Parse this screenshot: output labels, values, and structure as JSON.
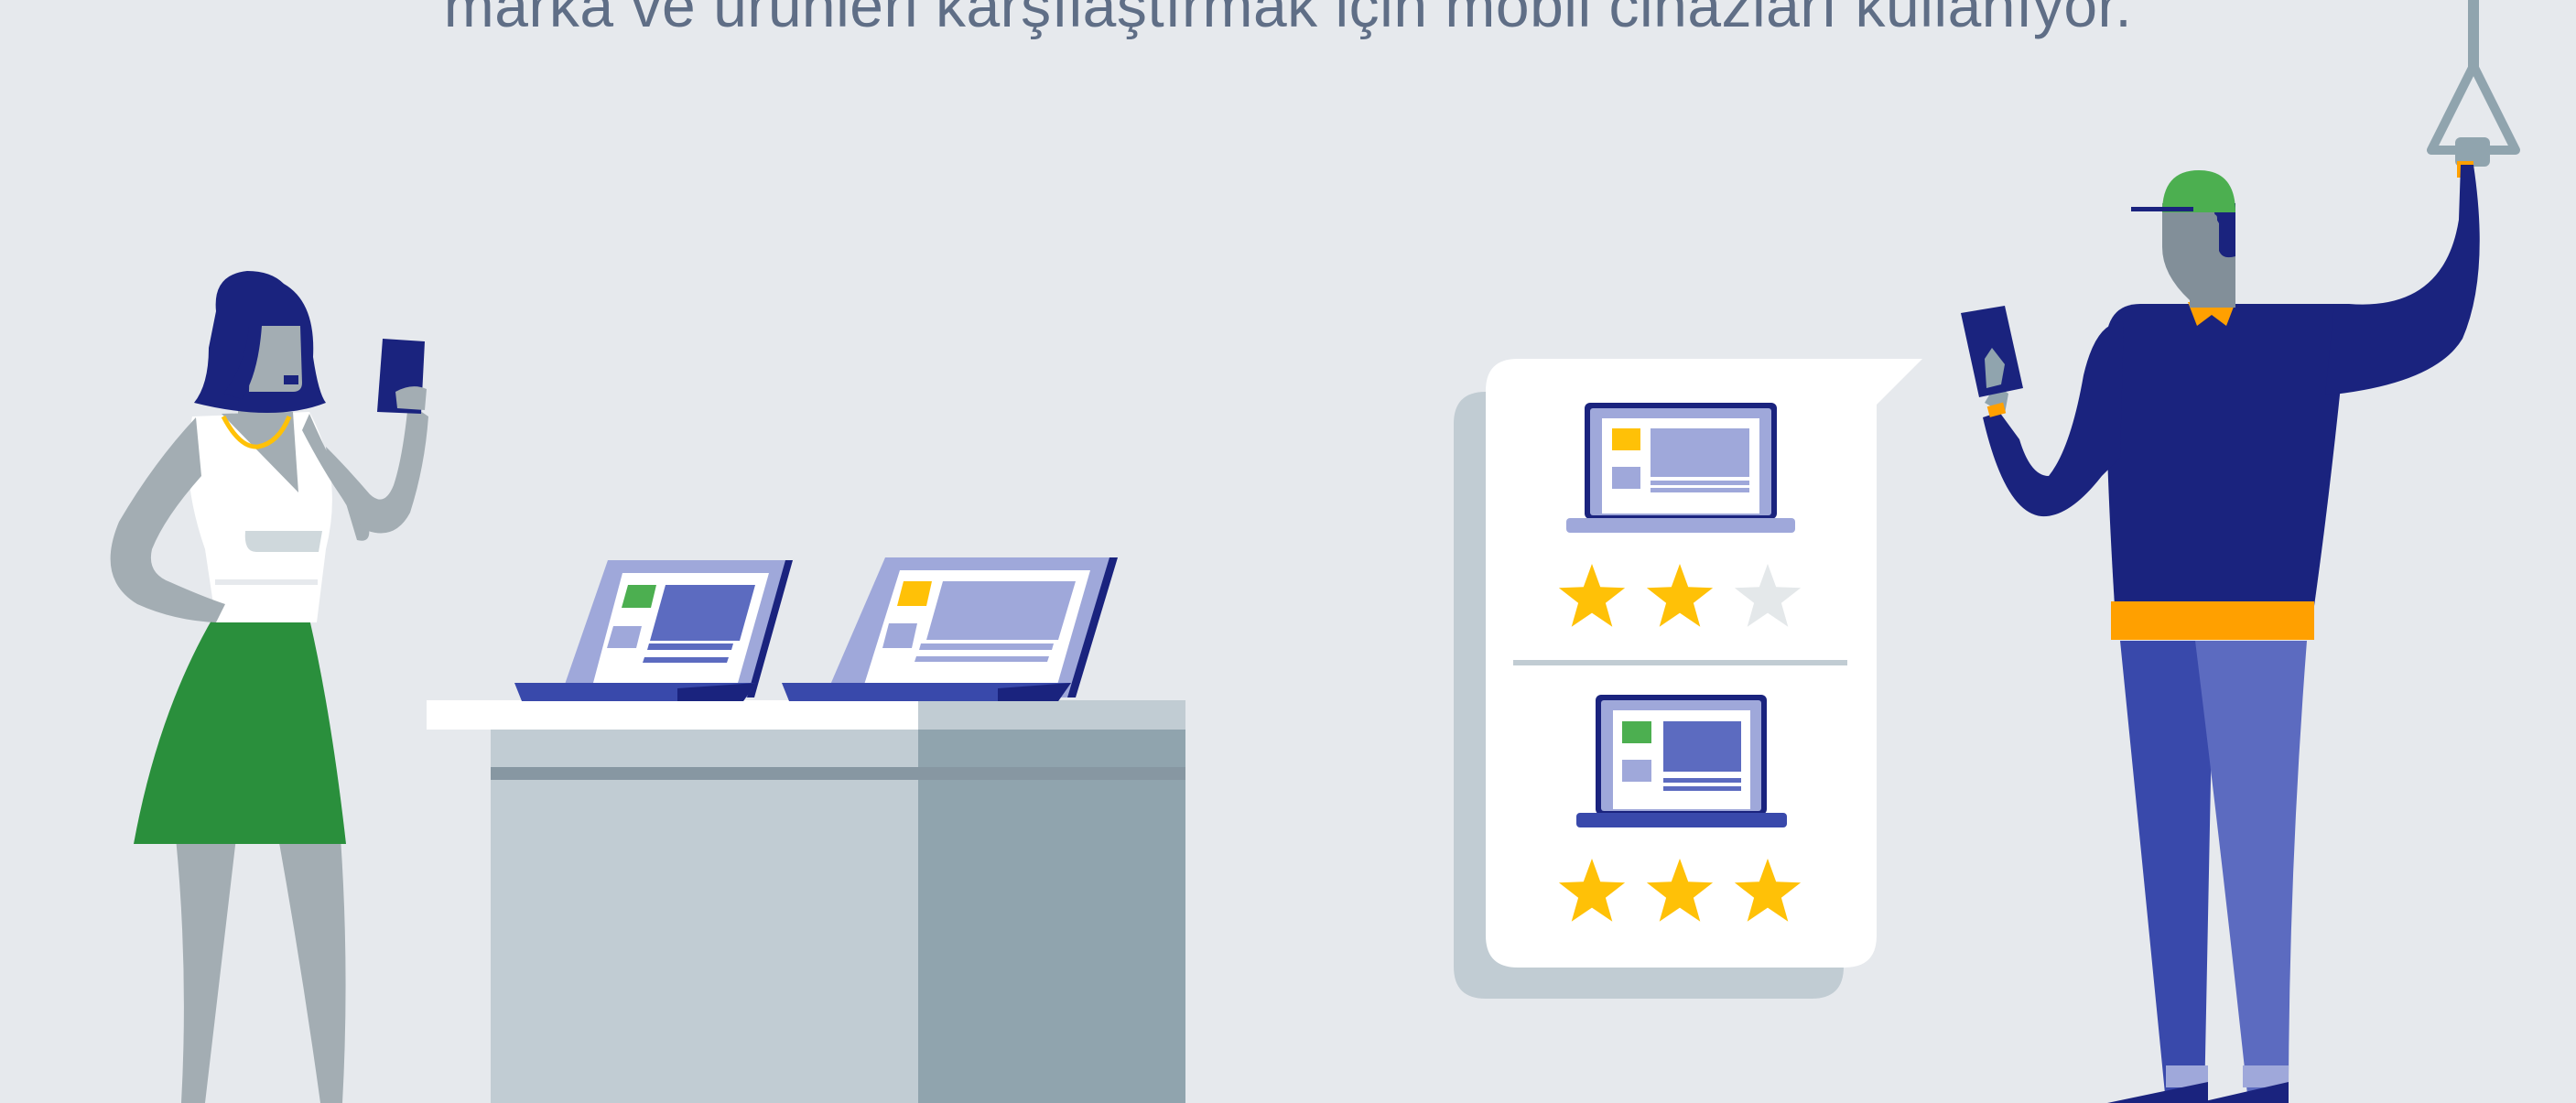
{
  "headline": "marka ve ürünleri karşılaştırmak için mobil cihazları kullanıyor.",
  "colors": {
    "background": "#e6e9ed",
    "navy": "#1a237e",
    "indigo": "#3949ab",
    "periwinkle": "#5c6bc0",
    "lavender": "#9fa8da",
    "green": "#2a8f3c",
    "cap_green": "#4caf50",
    "amber": "#ffa000",
    "star_yellow": "#ffc107",
    "skin_gray": "#a3adb3",
    "table_light": "#c1ccd3",
    "table_dark": "#90a4ae"
  },
  "review_card": {
    "product_1_rating": {
      "filled": 2,
      "max": 3
    },
    "product_2_rating": {
      "filled": 3,
      "max": 3
    }
  },
  "icons": [
    "laptop-icon",
    "star-icon",
    "smartphone-icon",
    "speech-bubble-icon"
  ]
}
